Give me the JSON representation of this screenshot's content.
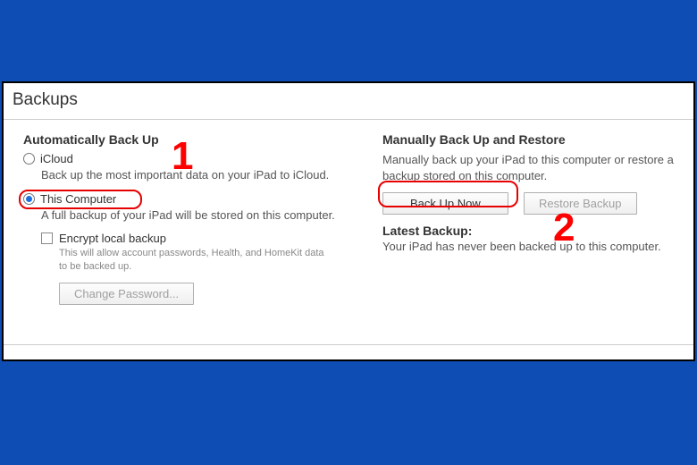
{
  "title": "Backups",
  "auto": {
    "heading": "Automatically Back Up",
    "icloud": {
      "label": "iCloud",
      "desc": "Back up the most important data on your iPad to iCloud."
    },
    "thiscomp": {
      "label": "This Computer",
      "desc": "A full backup of your iPad will be stored on this computer."
    },
    "encrypt": {
      "label": "Encrypt local backup",
      "desc": "This will allow account passwords, Health, and HomeKit data to be backed up."
    },
    "changepw": "Change Password..."
  },
  "manual": {
    "heading": "Manually Back Up and Restore",
    "desc": "Manually back up your iPad to this computer or restore a backup stored on this computer.",
    "backup_btn": "Back Up Now",
    "restore_btn": "Restore Backup"
  },
  "latest": {
    "heading": "Latest Backup:",
    "text": "Your iPad has never been backed up to this computer."
  },
  "annot": {
    "one": "1",
    "two": "2"
  }
}
